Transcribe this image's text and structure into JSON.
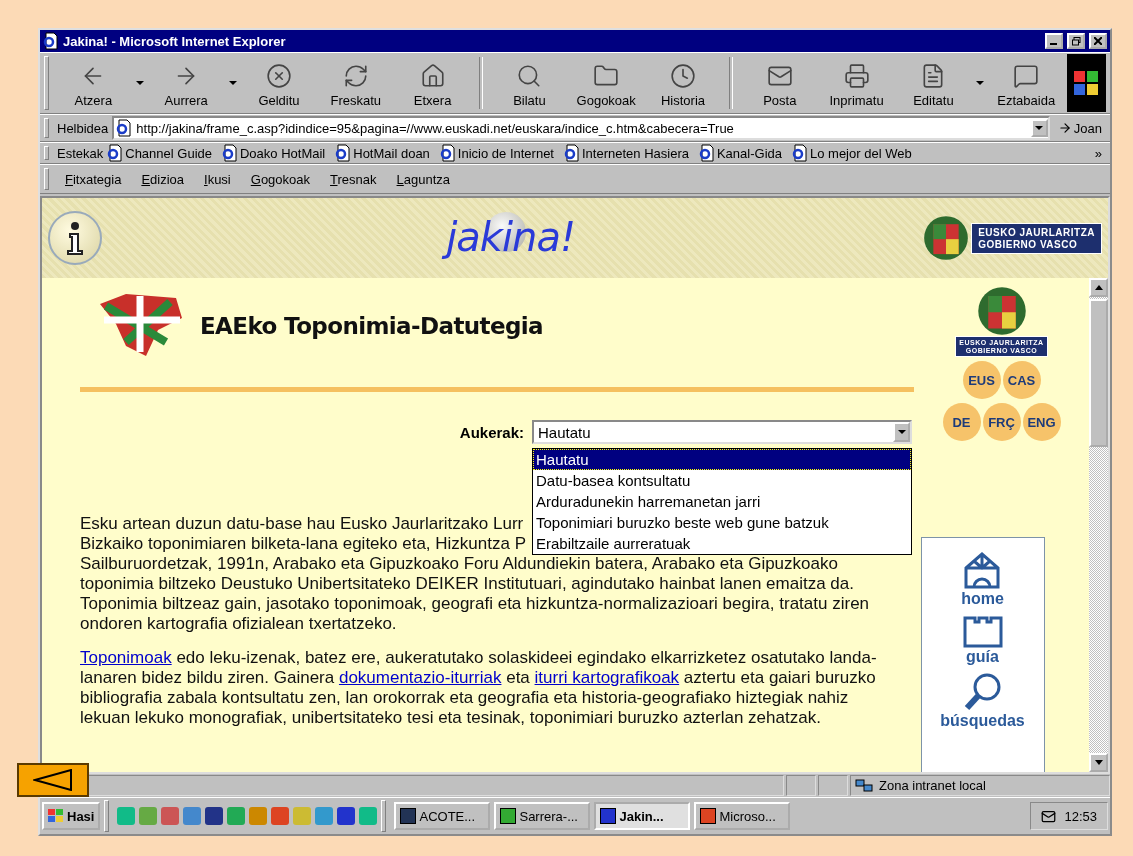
{
  "window": {
    "title": "Jakina! - Microsoft Internet Explorer"
  },
  "toolbar": {
    "buttons": [
      {
        "kind": "back",
        "label": "Atzera",
        "menu_arrow": true
      },
      {
        "kind": "forward",
        "label": "Aurrera",
        "menu_arrow": true
      },
      {
        "kind": "stop",
        "label": "Gelditu",
        "menu_arrow": false
      },
      {
        "kind": "refresh",
        "label": "Freskatu",
        "menu_arrow": false
      },
      {
        "kind": "home",
        "label": "Etxera",
        "menu_arrow": false
      },
      {
        "kind": "separator"
      },
      {
        "kind": "search",
        "label": "Bilatu",
        "menu_arrow": false
      },
      {
        "kind": "favorites",
        "label": "Gogokoak",
        "menu_arrow": false
      },
      {
        "kind": "history",
        "label": "Historia",
        "menu_arrow": false
      },
      {
        "kind": "separator"
      },
      {
        "kind": "mail",
        "label": "Posta",
        "menu_arrow": false
      },
      {
        "kind": "print",
        "label": "Inprimatu",
        "menu_arrow": false
      },
      {
        "kind": "edit",
        "label": "Editatu",
        "menu_arrow": true
      },
      {
        "kind": "discuss",
        "label": "Eztabaida",
        "menu_arrow": false
      }
    ]
  },
  "address": {
    "label": "Helbidea",
    "value": "http://jakina/frame_c.asp?idindice=95&pagina=//www.euskadi.net/euskara/indice_c.htm&cabecera=True",
    "go": "Joan"
  },
  "links": {
    "label": "Estekak",
    "items": [
      "Channel Guide",
      "Doako HotMail",
      "HotMail doan",
      "Inicio de Internet",
      "Interneten Hasiera",
      "Kanal-Gida",
      "Lo mejor del Web"
    ],
    "more": "»"
  },
  "menu": {
    "items": [
      "Fitxategia",
      "Edizioa",
      "Ikusi",
      "Gogokoak",
      "Tresnak",
      "Laguntza"
    ]
  },
  "page": {
    "header": {
      "logo": "jakina!",
      "gov_lines": [
        "EUSKO JAURLARITZA",
        "GOBIERNO VASCO"
      ]
    },
    "title": "EAEko Toponimia-Datutegia",
    "side_gov_lines": [
      "EUSKO JAURLARITZA",
      "GOBIERNO VASCO"
    ],
    "languages": [
      [
        "EUS",
        "CAS"
      ],
      [
        "DE",
        "FRÇ",
        "ENG"
      ]
    ],
    "select": {
      "label": "Aukerak:",
      "value": "Hautatu",
      "expanded": true,
      "options": [
        {
          "label": "Hautatu",
          "selected": true
        },
        {
          "label": "Datu-basea kontsultatu",
          "selected": false
        },
        {
          "label": "Arduradunekin harremanetan jarri",
          "selected": false
        },
        {
          "label": "Toponimiari buruzko beste web gune batzuk",
          "selected": false
        },
        {
          "label": "Erabiltzaile aurreratuak",
          "selected": false
        }
      ]
    },
    "paragraph_1_lines": [
      "Esku artean duzun datu-base hau Eusko Jaurlaritzako Lurr",
      "Bizkaiko toponimiaren bilketa-lana egiteko eta, Hizkuntza P",
      "Sailburuordetzak, 1991n, Arabako eta Gipuzkoako Foru Aldundiekin batera, Arabako eta Gipuzkoako",
      "toponimia biltzeko Deustuko Unibertsitateko DEIKER Institutuari, agindutako hainbat lanen emaitza da.",
      "Toponimia biltzeaz gain, jasotako toponimoak, geografi eta hizkuntza-normalizazioari begira, tratatu ziren",
      "ondoren kartografia ofizialean txertatzeko."
    ],
    "paragraph_2": [
      {
        "kind": "link",
        "text": "Toponimoak"
      },
      {
        "kind": "text",
        "text": " edo leku-izenak, batez ere, aukeratutako solaskideei egindako elkarrizketez osatutako landa-lanaren bidez bildu ziren. Gainera "
      },
      {
        "kind": "link",
        "text": "dokumentazio-iturriak"
      },
      {
        "kind": "text",
        "text": " eta "
      },
      {
        "kind": "link",
        "text": "iturri kartografikoak"
      },
      {
        "kind": "text",
        "text": " aztertu eta gaiari buruzko bibliografia zabala kontsultatu zen, lan orokorrak eta geografia eta historia-geografiako hiztegiak nahiz lekuan lekuko monografiak, unibertsitateko tesi eta tesinak, toponimiari buruzko azterlan zehatzak."
      }
    ],
    "nav": [
      {
        "kind": "home",
        "label": "home"
      },
      {
        "kind": "guide",
        "label": "guía"
      },
      {
        "kind": "search",
        "label": "búsquedas"
      }
    ]
  },
  "status_bar": {
    "zone": "Zona intranet local"
  },
  "taskbar": {
    "start": "Hasi",
    "tasks": [
      {
        "kind": "word",
        "label": "ACOTE...",
        "selected": false
      },
      {
        "kind": "clock",
        "label": "Sarrera-...",
        "selected": false
      },
      {
        "kind": "ie",
        "label": "Jakin...",
        "selected": true
      },
      {
        "kind": "ppt",
        "label": "Microso...",
        "selected": false
      }
    ],
    "clock": "12:53"
  }
}
